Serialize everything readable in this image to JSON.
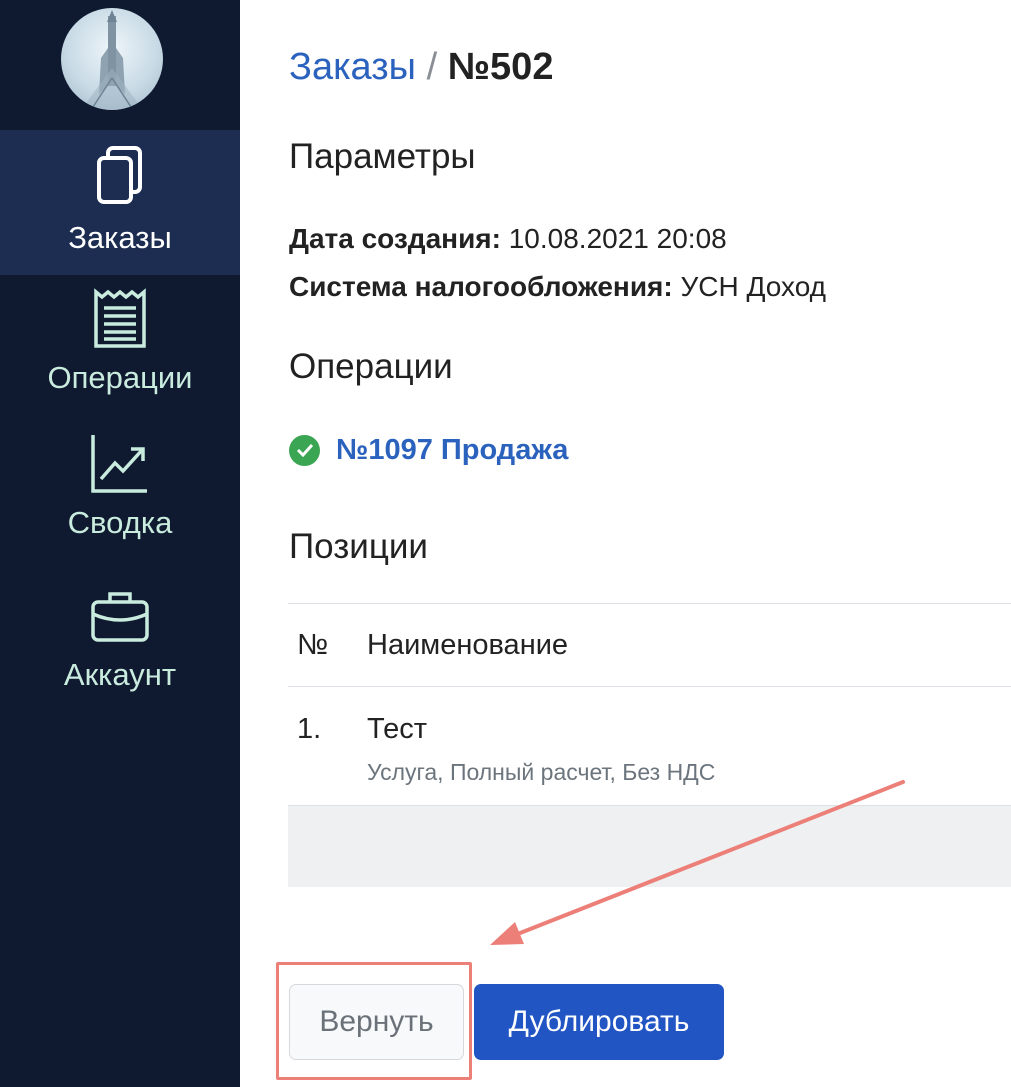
{
  "sidebar": {
    "items": [
      {
        "label": "Заказы",
        "icon": "documents-icon",
        "active": true
      },
      {
        "label": "Операции",
        "icon": "receipt-icon"
      },
      {
        "label": "Сводка",
        "icon": "chart-trend-icon"
      },
      {
        "label": "Аккаунт",
        "icon": "briefcase-icon"
      }
    ]
  },
  "breadcrumb": {
    "parent": "Заказы",
    "separator": "/",
    "current": "№502"
  },
  "params": {
    "title": "Параметры",
    "created_label": "Дата создания:",
    "created_value": "10.08.2021 20:08",
    "tax_label": "Система налогообложения:",
    "tax_value": "УСН Доход"
  },
  "operations": {
    "title": "Операции",
    "items": [
      {
        "label": "№1097 Продажа",
        "status": "success"
      }
    ]
  },
  "positions": {
    "title": "Позиции",
    "columns": [
      "№",
      "Наименование"
    ],
    "rows": [
      {
        "num": "1.",
        "name": "Тест",
        "details": "Услуга, Полный расчет, Без НДС"
      }
    ]
  },
  "actions": {
    "return_label": "Вернуть",
    "duplicate_label": "Дублировать"
  },
  "colors": {
    "sidebar_bg": "#0f1a30",
    "active_bg": "#1d2d51",
    "link": "#2a62bd",
    "primary": "#2155c4",
    "annotation": "#ec7f78",
    "success": "#3aa552"
  }
}
